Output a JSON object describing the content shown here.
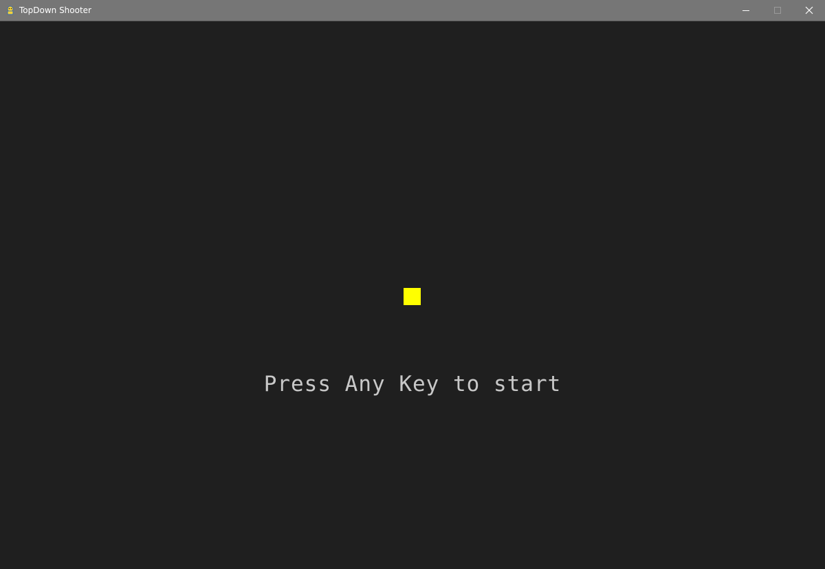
{
  "window": {
    "title": "TopDown Shooter",
    "app_icon": "pygame-snake-icon",
    "controls": {
      "minimize_icon": "minimize-icon",
      "maximize_icon": "maximize-icon",
      "close_icon": "close-icon"
    }
  },
  "game": {
    "background_color": "#1f1f1f",
    "player": {
      "color": "#ffff00"
    },
    "start_prompt": "Press Any Key to start",
    "start_prompt_color": "#c8c8c8"
  }
}
